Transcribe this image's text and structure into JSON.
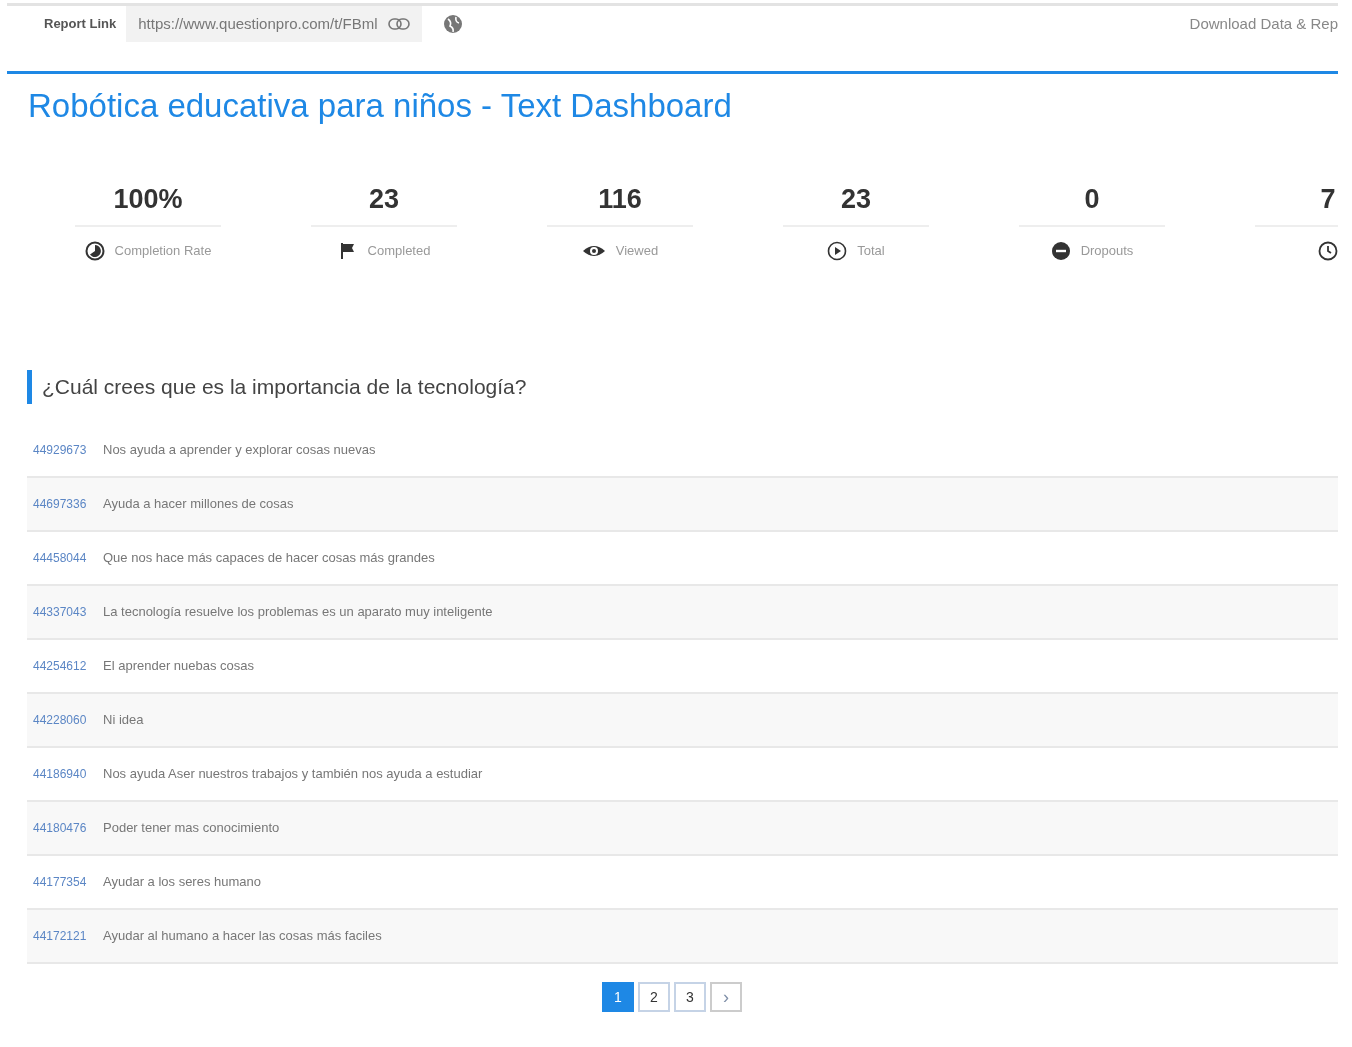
{
  "header": {
    "report_link_label": "Report Link",
    "report_url": "https://www.questionpro.com/t/FBml",
    "download": "Download Data & Rep"
  },
  "title": "Robótica educativa para niños - Text Dashboard",
  "stats": [
    {
      "value": "100%",
      "label": "Completion Rate",
      "kind": "completion"
    },
    {
      "value": "23",
      "label": "Completed",
      "kind": "completed"
    },
    {
      "value": "116",
      "label": "Viewed",
      "kind": "viewed"
    },
    {
      "value": "23",
      "label": "Total",
      "kind": "total"
    },
    {
      "value": "0",
      "label": "Dropouts",
      "kind": "dropouts"
    },
    {
      "value": "7",
      "kind": "time"
    }
  ],
  "question": "¿Cuál crees que es la importancia de la tecnología?",
  "responses": [
    {
      "id": "44929673",
      "text": "Nos ayuda a aprender y explorar cosas nuevas"
    },
    {
      "id": "44697336",
      "text": "Ayuda a hacer millones de cosas"
    },
    {
      "id": "44458044",
      "text": "Que nos hace más capaces de hacer cosas más grandes"
    },
    {
      "id": "44337043",
      "text": "La tecnología resuelve los problemas es un aparato muy inteligente"
    },
    {
      "id": "44254612",
      "text": "El aprender nuebas cosas"
    },
    {
      "id": "44228060",
      "text": "Ni idea"
    },
    {
      "id": "44186940",
      "text": "Nos ayuda Aser nuestros trabajos y también nos ayuda a estudiar"
    },
    {
      "id": "44180476",
      "text": "Poder tener mas conocimiento"
    },
    {
      "id": "44177354",
      "text": "Ayudar a los seres humano"
    },
    {
      "id": "44172121",
      "text": "Ayudar al humano a hacer las cosas más faciles"
    }
  ],
  "pagination": {
    "pages": [
      {
        "label": "1",
        "selected": true
      },
      {
        "label": "2",
        "selected": false
      },
      {
        "label": "3",
        "selected": false
      }
    ],
    "next": "›"
  }
}
